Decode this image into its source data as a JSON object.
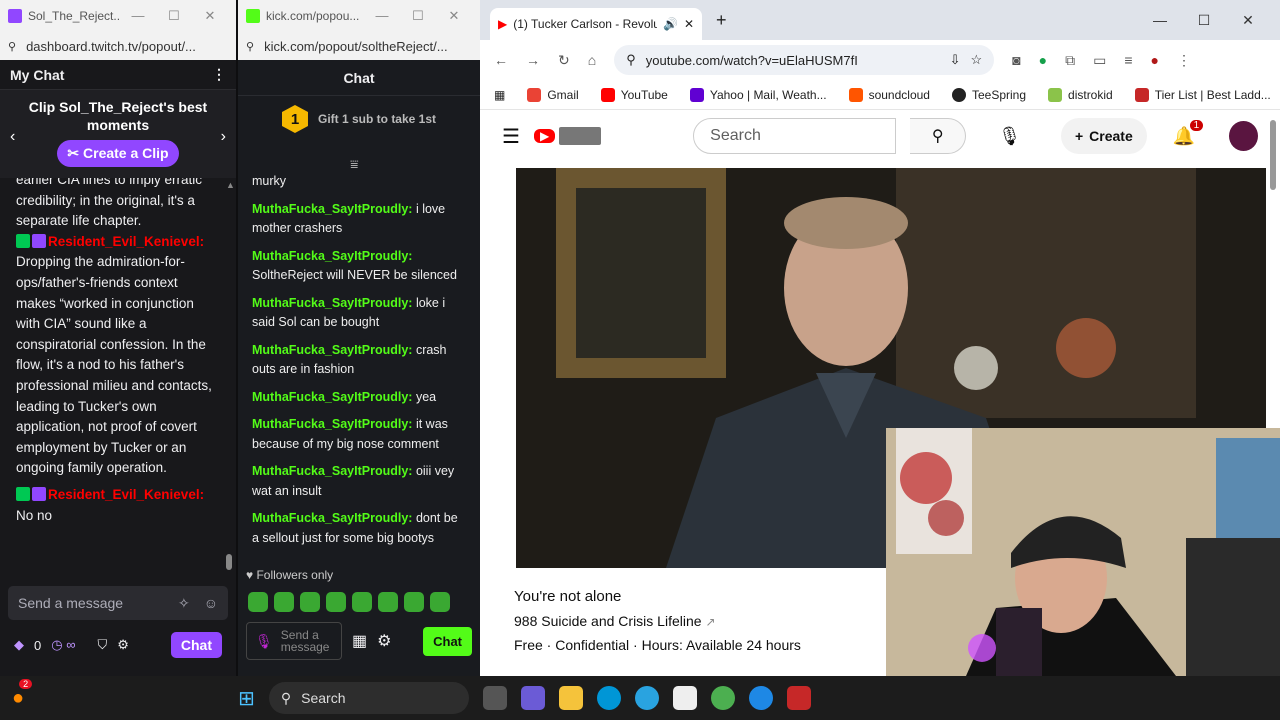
{
  "twitch": {
    "tab_title": "Sol_The_Reject...",
    "url": "dashboard.twitch.tv/popout/...",
    "header": "My Chat",
    "clip_title": "Clip Sol_The_Reject's best moments",
    "clip_button": "Create a Clip",
    "messages": [
      {
        "text": "earlier CIA lines to imply erratic credibility; in the original, it's a separate life chapter."
      },
      {
        "user": "Resident_Evil_Kenievel:",
        "text": "Dropping the admiration-for-ops/father's-friends context makes “worked in conjunction with CIA” sound like a conspiratorial confession. In the flow, it's a nod to his father's professional milieu and contacts, leading to Tucker's own application, not proof of covert employment by Tucker or an ongoing family operation."
      },
      {
        "user": "Resident_Evil_Kenievel:",
        "text": "No no"
      }
    ],
    "input_placeholder": "Send a message",
    "points": "0",
    "chat_button": "Chat"
  },
  "kick": {
    "tab_title": "kick.com/popou...",
    "url": "kick.com/popout/soltheReject/...",
    "header": "Chat",
    "gift_number": "1",
    "gift_text": "Gift 1 sub to take 1st",
    "first_line": "murky",
    "messages": [
      {
        "user": "MuthaFucka_SayItProudly:",
        "text": "i love mother crashers"
      },
      {
        "user": "MuthaFucka_SayItProudly:",
        "text": "SoltheReject will NEVER be silenced"
      },
      {
        "user": "MuthaFucka_SayItProudly:",
        "text": "loke i said Sol can be bought"
      },
      {
        "user": "MuthaFucka_SayItProudly:",
        "text": "crash outs are in fashion"
      },
      {
        "user": "MuthaFucka_SayItProudly:",
        "text": "yea"
      },
      {
        "user": "MuthaFucka_SayItProudly:",
        "text": "it was because of my big nose comment"
      },
      {
        "user": "MuthaFucka_SayItProudly:",
        "text": "oiii vey wat an insult"
      },
      {
        "user": "MuthaFucka_SayItProudly:",
        "text": "dont be a sellout just for some big bootys"
      }
    ],
    "followers_only": "Followers only",
    "input_placeholder": "Send a message",
    "chat_button": "Chat"
  },
  "youtube": {
    "tab_title": "(1) Tucker Carlson - Revolu",
    "url": "youtube.com/watch?v=uElaHUSM7fI",
    "bookmarks": [
      "Gmail",
      "YouTube",
      "Yahoo | Mail, Weath...",
      "soundcloud",
      "TeeSpring",
      "distrokid",
      "Tier List | Best Ladd..."
    ],
    "search_placeholder": "Search",
    "create_label": "Create",
    "notif_count": "1",
    "alone_heading": "You're not alone",
    "alone_line1": "988 Suicide and Crisis Lifeline",
    "alone_line2": "Free · Confidential · Hours: Available 24 hours"
  },
  "taskbar": {
    "search": "Search",
    "badge": "2"
  }
}
